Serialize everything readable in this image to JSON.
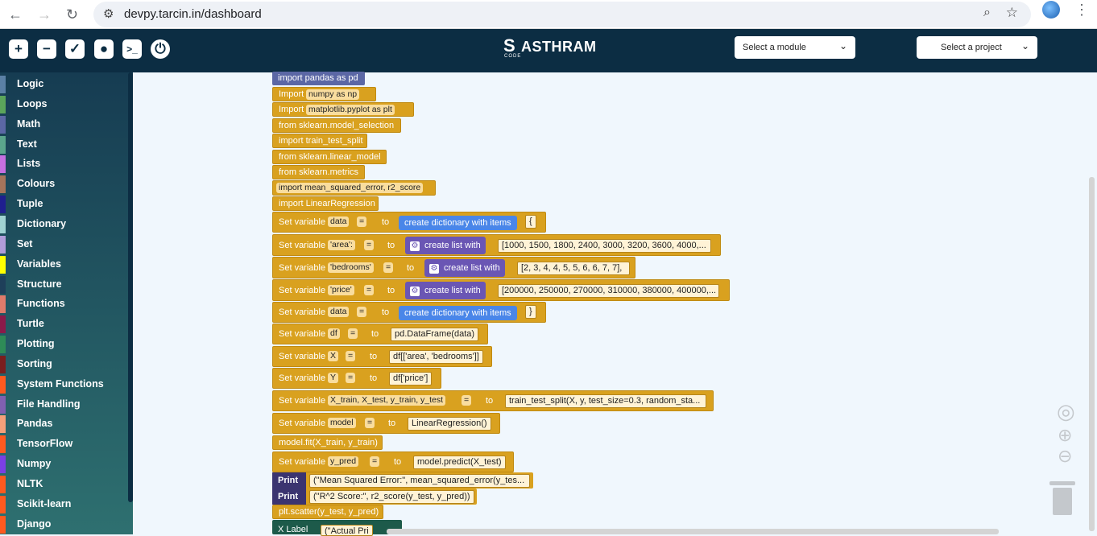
{
  "browser": {
    "url": "devpy.tarcin.in/dashboard"
  },
  "header": {
    "brand": "ASTHRAM",
    "brand_sub": "CODE",
    "module_select": "Select a module",
    "project_select": "Select a project",
    "toolbar_icons": [
      "new-file-icon",
      "delete-icon",
      "check-icon",
      "lock-icon",
      "terminal-icon",
      "power-icon"
    ]
  },
  "sidebar": {
    "categories": [
      {
        "label": "Logic",
        "color": "#5b80a5"
      },
      {
        "label": "Loops",
        "color": "#5ba55b"
      },
      {
        "label": "Math",
        "color": "#5b67a5"
      },
      {
        "label": "Text",
        "color": "#5ba58c"
      },
      {
        "label": "Lists",
        "color": "#c56fe0"
      },
      {
        "label": "Colours",
        "color": "#a5745b"
      },
      {
        "label": "Tuple",
        "color": "#1f1f8f"
      },
      {
        "label": "Dictionary",
        "color": "#a0d2d2"
      },
      {
        "label": "Set",
        "color": "#b19cd9"
      },
      {
        "label": "Variables",
        "color": "#ffff00"
      },
      {
        "label": "Structure",
        "color": "#1e3f5a"
      },
      {
        "label": "Functions",
        "color": "#e07b6b"
      },
      {
        "label": "Turtle",
        "color": "#8b1a4a"
      },
      {
        "label": "Plotting",
        "color": "#2e8b57"
      },
      {
        "label": "Sorting",
        "color": "#7a1e1e"
      },
      {
        "label": "System Functions",
        "color": "#ff5a1f"
      },
      {
        "label": "File Handling",
        "color": "#8060b0"
      },
      {
        "label": "Pandas",
        "color": "#f4a07a"
      },
      {
        "label": "TensorFlow",
        "color": "#ff5a1f"
      },
      {
        "label": "Numpy",
        "color": "#7b3fe4"
      },
      {
        "label": "NLTK",
        "color": "#ff5a1f"
      },
      {
        "label": "Scikit-learn",
        "color": "#ff5a1f"
      },
      {
        "label": "Django",
        "color": "#ff5a1f"
      }
    ]
  },
  "blocks": {
    "b1": "import pandas as pd",
    "b2_kw": "Import",
    "b2_val": "numpy as np",
    "b3_kw": "Import",
    "b3_val": "matplotlib.pyplot as plt",
    "b4": "from sklearn.model_selection",
    "b5": "import train_test_split",
    "b6": "from sklearn.linear_model",
    "b7": "from sklearn.metrics",
    "b8": "import mean_squared_error, r2_score",
    "b9": "import LinearRegression",
    "set": "Set variable",
    "to": "to",
    "eq": "=",
    "v_data": "data",
    "create_dict": "create dictionary with items",
    "brace_open": "{",
    "v_area": "'area':",
    "create_list": "create list with",
    "area_vals": "[1000, 1500, 1800, 2400, 3000, 3200, 3600, 4000,...",
    "v_bedrooms": "'bedrooms'",
    "bed_vals": "[2, 3, 4, 4, 5, 5, 6, 6, 7, 7],",
    "v_price": "'price'",
    "price_vals": "[200000, 250000, 270000, 310000, 380000, 400000,...",
    "brace_close": "}",
    "v_df": "df",
    "df_val": "pd.DataFrame(data)",
    "v_x": "X",
    "x_val": "df[['area', 'bedrooms']]",
    "v_y": "Y",
    "y_val": "df['price']",
    "v_split": "X_train, X_test, y_train, y_test",
    "split_val": "train_test_split(X, y, test_size=0.3, random_sta...",
    "v_model": "model",
    "model_val": "LinearRegression()",
    "fit": "model.fit(X_train, y_train)",
    "v_ypred": "y_pred",
    "ypred_val": "model.predict(X_test)",
    "print": "Print",
    "print1": "(\"Mean Squared Error:\", mean_squared_error(y_tes...",
    "print2": "(\"R^2 Score:\", r2_score(y_test, y_pred))",
    "scatter": "plt.scatter(y_test, y_pred)",
    "xlabel": "X Label",
    "xlabel_val": "(\"Actual Pri"
  }
}
